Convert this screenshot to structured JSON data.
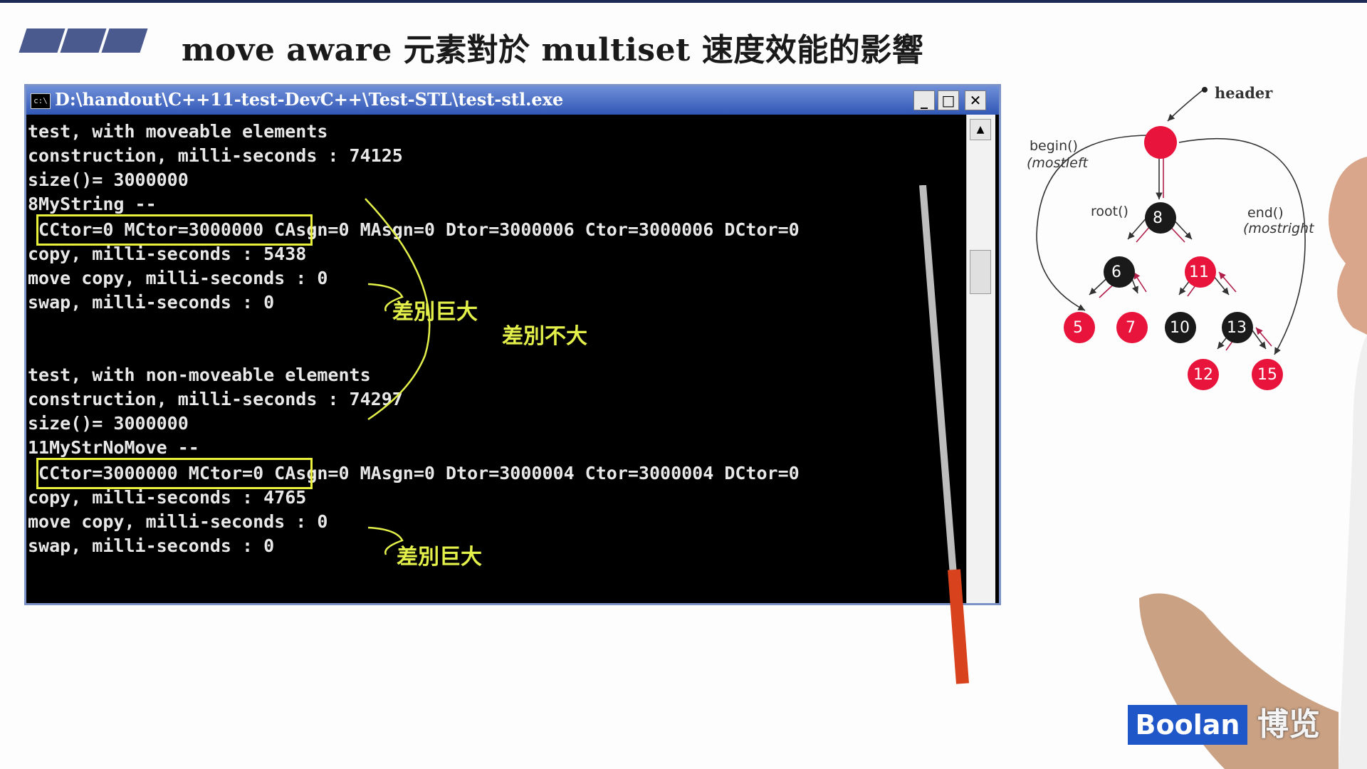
{
  "slide": {
    "title": "move aware 元素對於 multiset 速度效能的影響"
  },
  "window": {
    "icon_text": "c:\\",
    "title": "D:\\handout\\C++11-test-DevC++\\Test-STL\\test-stl.exe",
    "minimize": "_",
    "maximize": "□",
    "close": "✕",
    "scroll_up": "▲"
  },
  "console": {
    "lines": [
      "test, with moveable elements",
      "construction, milli-seconds : 74125",
      "size()= 3000000",
      "8MyString --",
      " CCtor=0 MCtor=3000000 CAsgn=0 MAsgn=0 Dtor=3000006 Ctor=3000006 DCtor=0",
      "copy, milli-seconds : 5438",
      "move copy, milli-seconds : 0",
      "swap, milli-seconds : 0",
      "",
      "",
      "test, with non-moveable elements",
      "construction, milli-seconds : 74297",
      "size()= 3000000",
      "11MyStrNoMove --",
      " CCtor=3000000 MCtor=0 CAsgn=0 MAsgn=0 Dtor=3000004 Ctor=3000004 DCtor=0",
      "copy, milli-seconds : 4765",
      "move copy, milli-seconds : 0",
      "swap, milli-seconds : 0"
    ]
  },
  "annotations": {
    "big_diff_1": "差別巨大",
    "small_diff": "差別不大",
    "big_diff_2": "差別巨大",
    "highlight_color": "#e8f03a"
  },
  "tree": {
    "header": "header",
    "begin": "begin()",
    "begin_sub": "(mostleft",
    "root": "root()",
    "end": "end()",
    "end_sub": "(mostright",
    "nodes": [
      "8",
      "6",
      "11",
      "5",
      "7",
      "10",
      "13",
      "12",
      "15"
    ],
    "red_color": "#e8143c",
    "black_color": "#1a1a1a"
  },
  "branding": {
    "logo": "Boolan",
    "logo_cn": "博览",
    "logo_color": "#1f57c9"
  }
}
